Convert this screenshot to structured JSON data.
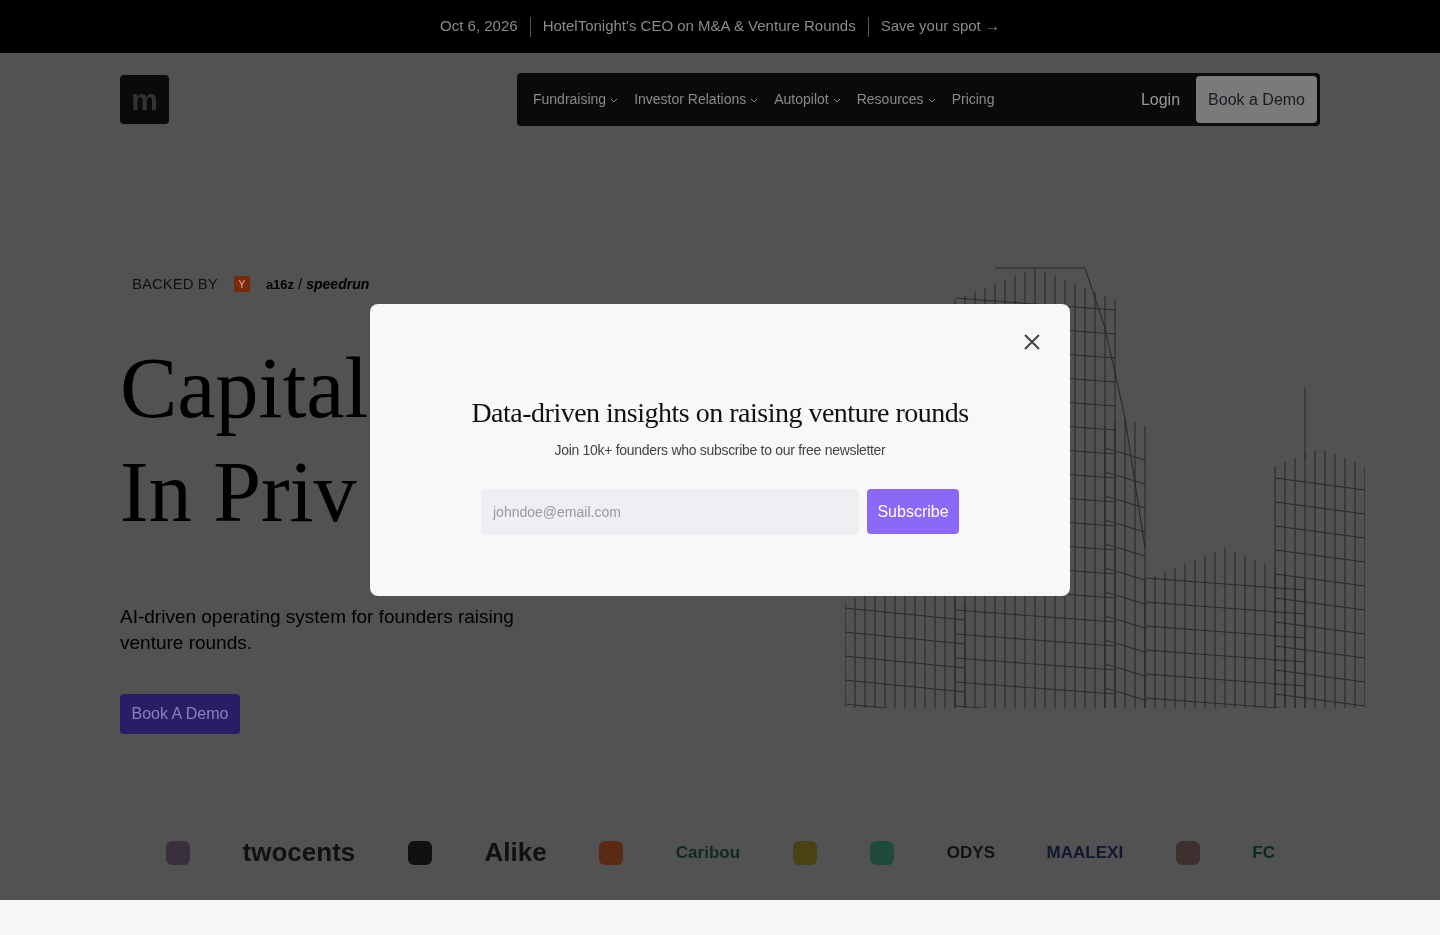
{
  "banner": {
    "date": "Oct 6, 2026",
    "headline": "HotelTonight's CEO on M&A & Venture Rounds",
    "link": "Save your spot →"
  },
  "nav": {
    "logo": "m",
    "items": [
      {
        "label": "Fundraising",
        "has_menu": true
      },
      {
        "label": "Investor Relations",
        "has_menu": true
      },
      {
        "label": "Autopilot",
        "has_menu": true
      },
      {
        "label": "Resources",
        "has_menu": true
      },
      {
        "label": "Pricing",
        "has_menu": false
      }
    ],
    "login": "Login",
    "cta": "Book a Demo"
  },
  "hero": {
    "backed_by": "BACKED BY",
    "yc": "Y",
    "a16z": "a16z",
    "separator": "/",
    "speedrun": "speedrun",
    "headline": [
      "Capital",
      "In Priv"
    ],
    "subtitle": "AI-driven operating system for founders raising venture rounds.",
    "cta": "Book A Demo"
  },
  "logos": [
    {
      "kind": "icon",
      "color": "#3a2f3c"
    },
    {
      "kind": "wordmark",
      "text": "twocents",
      "color": "#111111"
    },
    {
      "kind": "icon",
      "color": "#111111"
    },
    {
      "kind": "wordmark",
      "text": "Alike",
      "color": "#111111"
    },
    {
      "kind": "icon",
      "color": "#5a2a14"
    },
    {
      "kind": "wordmark",
      "text": "Caribou",
      "color": "#0e2a20"
    },
    {
      "kind": "icon",
      "color": "#4a4212"
    },
    {
      "kind": "icon",
      "color": "#1f4a3c"
    },
    {
      "kind": "wordmark",
      "text": "ODYS",
      "color": "#111111"
    },
    {
      "kind": "wordmark",
      "text": "MAALEXI",
      "color": "#101830"
    },
    {
      "kind": "icon",
      "color": "#3f3030"
    },
    {
      "kind": "wordmark",
      "text": "FC",
      "color": "#0c2a22"
    }
  ],
  "modal": {
    "title": "Data-driven insights on raising venture rounds",
    "subtitle": "Join 10k+ founders who subscribe to our free newsletter",
    "email_placeholder": "johndoe@email.com",
    "button": "Subscribe"
  }
}
